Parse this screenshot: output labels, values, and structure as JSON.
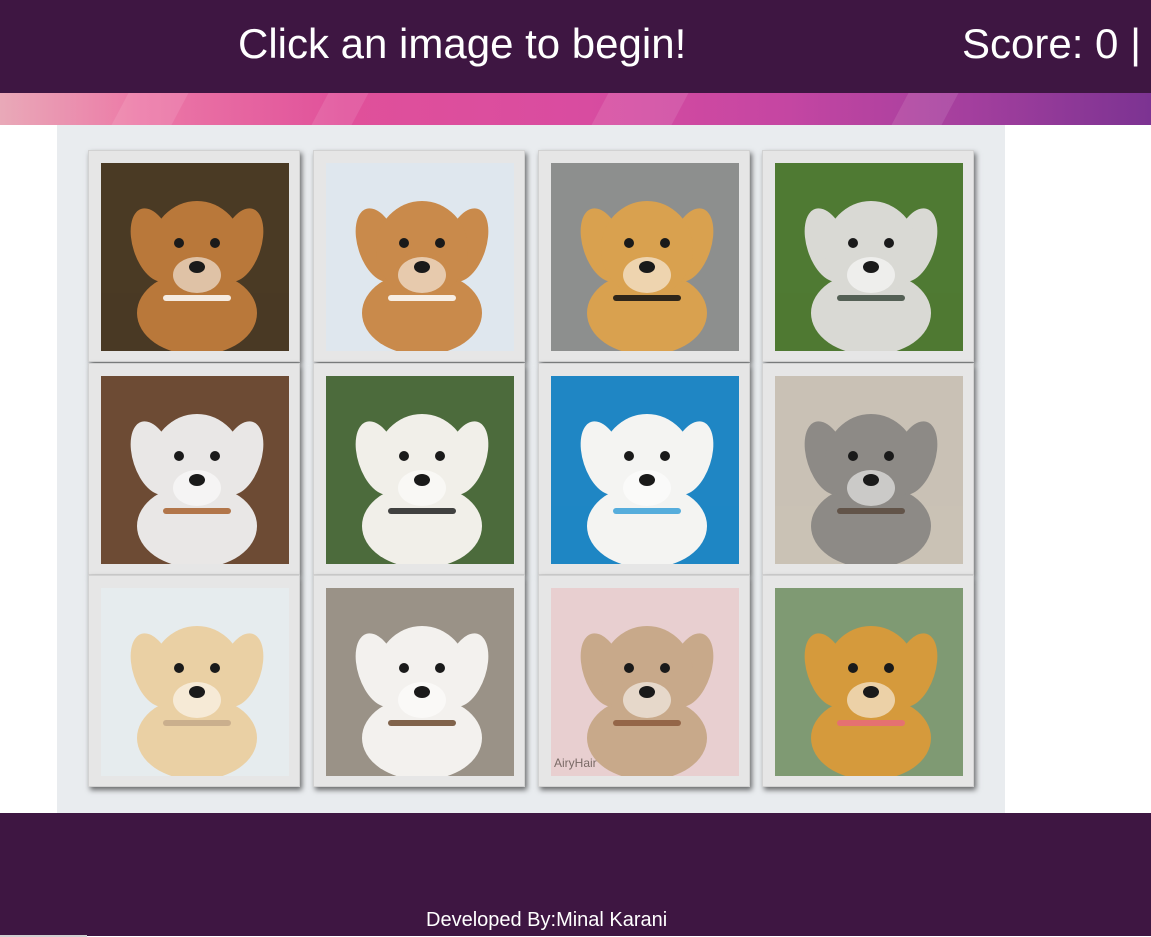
{
  "header": {
    "prompt": "Click an image to begin!",
    "score_text": "Score: 0 |"
  },
  "grid": {
    "columns": 4,
    "rows": 3,
    "tiles": [
      {
        "icon": "beagle-puppy-photo",
        "bg": "#4a3a24",
        "fur": "#b9783a",
        "accent": "#ffffff"
      },
      {
        "icon": "corgi-puppy-photo",
        "bg": "#dfe7ee",
        "fur": "#c98a4b",
        "accent": "#ffffff"
      },
      {
        "icon": "golden-retriever-puppy-photo",
        "bg": "#8d8f8e",
        "fur": "#d9a14f",
        "accent": "#111111"
      },
      {
        "icon": "husky-photo",
        "bg": "#4f7a33",
        "fur": "#d9d9d4",
        "accent": "#3c4a3e"
      },
      {
        "icon": "australian-shepherd-puppy-photo",
        "bg": "#6d4b34",
        "fur": "#e9e7e6",
        "accent": "#a8612e"
      },
      {
        "icon": "white-fluffy-dog-photo",
        "bg": "#4c6b3c",
        "fur": "#f1efe9",
        "accent": "#222222"
      },
      {
        "icon": "maltese-dog-photo",
        "bg": "#1f86c4",
        "fur": "#f4f4f2",
        "accent": "#3aa0d8"
      },
      {
        "icon": "merle-puppy-photo",
        "bg": "#c9c1b5",
        "fur": "#8d8a86",
        "accent": "#5a4a3e"
      },
      {
        "icon": "labrador-puppy-photo",
        "bg": "#e6ecee",
        "fur": "#ead0a4",
        "accent": "#c4a98a"
      },
      {
        "icon": "shih-tzu-photo",
        "bg": "#9a9287",
        "fur": "#f3f1ee",
        "accent": "#6b4a2e"
      },
      {
        "icon": "groomed-shih-tzu-photo",
        "bg": "#e8cfd0",
        "fur": "#c8a98a",
        "accent": "#8b5a3c",
        "watermark": "AiryHair"
      },
      {
        "icon": "golden-puppy-photo",
        "bg": "#7f9a73",
        "fur": "#d59a3c",
        "accent": "#e86a7a"
      }
    ]
  },
  "footer": {
    "credit": "Developed By:Minal Karani"
  },
  "colors": {
    "header_bg": "#3e1642",
    "board_bg": "#e9ecef",
    "tile_bg": "#e6e6e6"
  }
}
